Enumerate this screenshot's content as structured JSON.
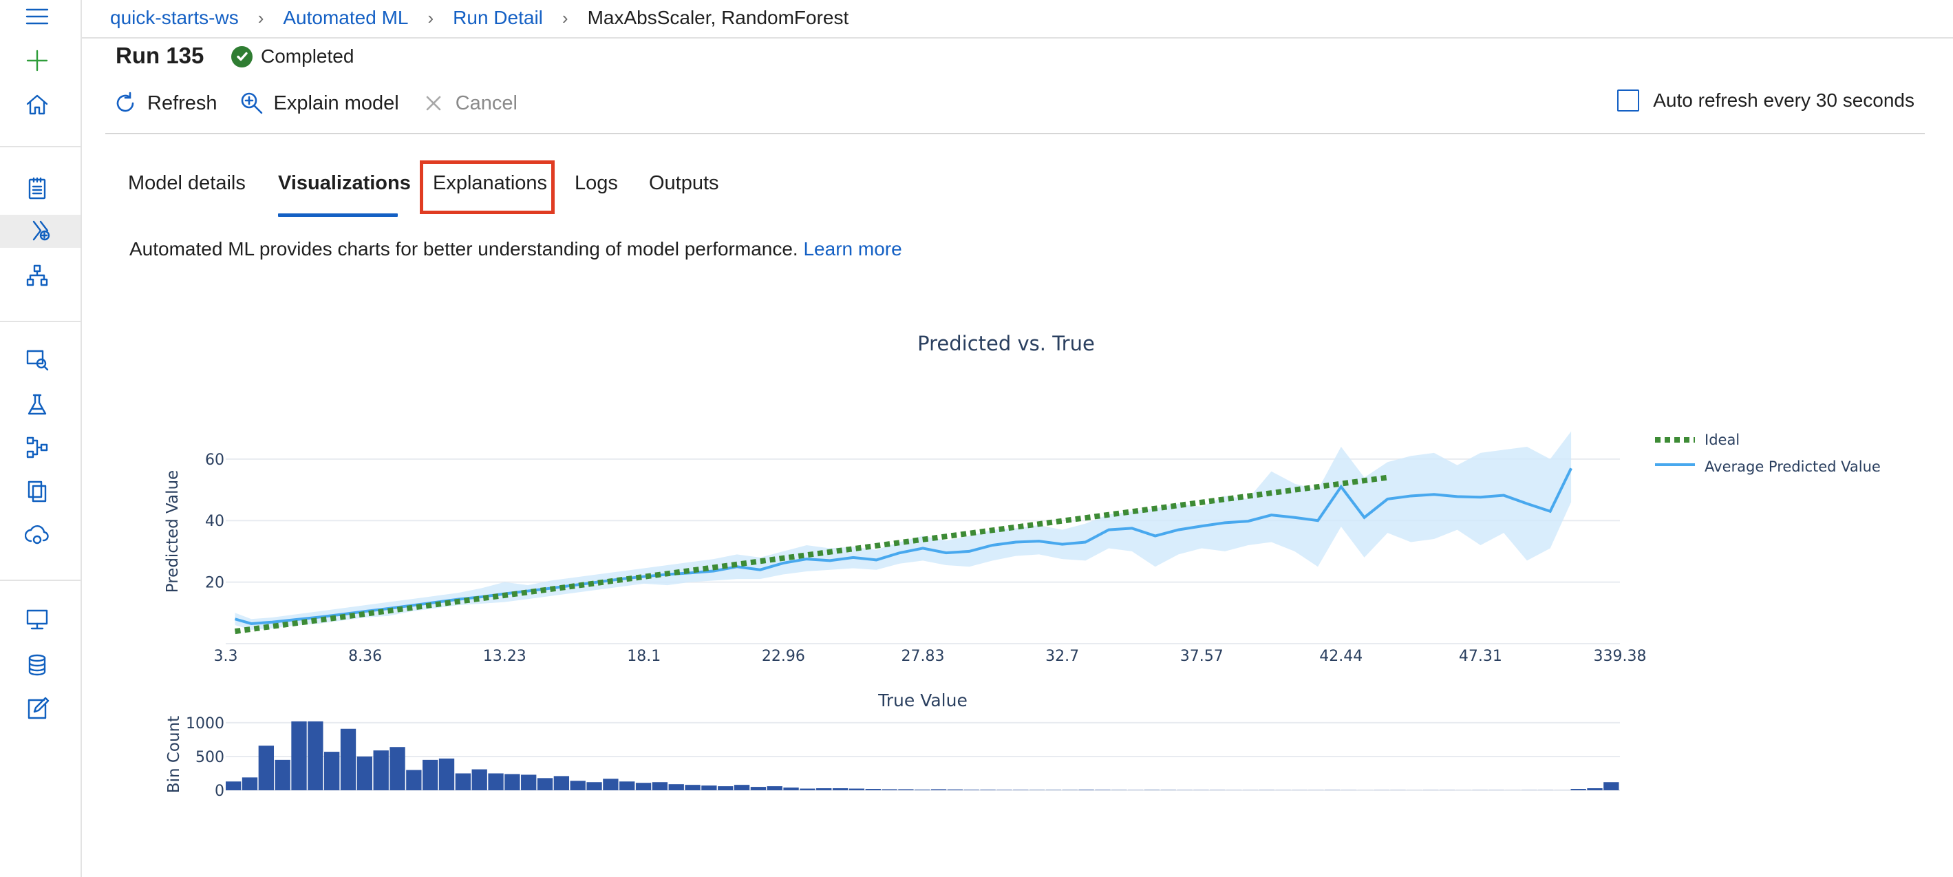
{
  "breadcrumb": {
    "items": [
      "quick-starts-ws",
      "Automated ML",
      "Run Detail"
    ],
    "current": "MaxAbsScaler, RandomForest"
  },
  "run": {
    "title": "Run 135",
    "status": "Completed"
  },
  "toolbar": {
    "refresh": "Refresh",
    "explain": "Explain model",
    "cancel": "Cancel",
    "auto_refresh": "Auto refresh every 30 seconds"
  },
  "tabs": [
    {
      "label": "Model details",
      "active": false
    },
    {
      "label": "Visualizations",
      "active": true
    },
    {
      "label": "Explanations",
      "active": false,
      "highlighted": true
    },
    {
      "label": "Logs",
      "active": false
    },
    {
      "label": "Outputs",
      "active": false
    }
  ],
  "description": {
    "text": "Automated ML provides charts for better understanding of model performance.",
    "link": "Learn more"
  },
  "colors": {
    "accent": "#1460c4",
    "ideal": "#3d8b35",
    "predicted": "#48a8ee",
    "band": "#cfe8fb",
    "histogram": "#2d55a4",
    "highlight": "#e03c22"
  },
  "chart_data": [
    {
      "type": "line",
      "title": "Predicted vs. True",
      "xlabel": "True Value",
      "ylabel": "Predicted Value",
      "x_ticks": [
        "3.3",
        "8.36",
        "13.23",
        "18.1",
        "22.96",
        "27.83",
        "32.7",
        "37.57",
        "42.44",
        "47.31",
        "339.38"
      ],
      "y_ticks": [
        20,
        40,
        60
      ],
      "ylim": [
        0,
        66
      ],
      "legend_position": "top-right",
      "series": [
        {
          "name": "Ideal",
          "style": "dotted",
          "points": [
            [
              0.4,
              4
            ],
            [
              50,
              54
            ]
          ]
        },
        {
          "name": "Average Predicted Value",
          "style": "solid",
          "points": [
            [
              0.4,
              8
            ],
            [
              1.1,
              6.5
            ],
            [
              2,
              7
            ],
            [
              3,
              7.8
            ],
            [
              4,
              8.6
            ],
            [
              5,
              9.5
            ],
            [
              6,
              10.5
            ],
            [
              7,
              11.4
            ],
            [
              8,
              12.4
            ],
            [
              9,
              13.4
            ],
            [
              10,
              14.4
            ],
            [
              11,
              15.2
            ],
            [
              12,
              16.2
            ],
            [
              13,
              17.1
            ],
            [
              14,
              18
            ],
            [
              15,
              19
            ],
            [
              16,
              20
            ],
            [
              17,
              21
            ],
            [
              18,
              21.8
            ],
            [
              19,
              22.5
            ],
            [
              20,
              23
            ],
            [
              21,
              23.6
            ],
            [
              22,
              25
            ],
            [
              23,
              24
            ],
            [
              24,
              26.2
            ],
            [
              25,
              27.5
            ],
            [
              26,
              27
            ],
            [
              27,
              28
            ],
            [
              28,
              27.2
            ],
            [
              29,
              29.5
            ],
            [
              30,
              31
            ],
            [
              31,
              29.5
            ],
            [
              32,
              30
            ],
            [
              33,
              32
            ],
            [
              34,
              33
            ],
            [
              35,
              33.3
            ],
            [
              36,
              32.3
            ],
            [
              37,
              33
            ],
            [
              38,
              37
            ],
            [
              39,
              37.5
            ],
            [
              40,
              35
            ],
            [
              41,
              37
            ],
            [
              42,
              38.2
            ],
            [
              43,
              39.3
            ],
            [
              44,
              39.8
            ],
            [
              45,
              41.8
            ],
            [
              46,
              41
            ],
            [
              47,
              40
            ],
            [
              48,
              51
            ],
            [
              49,
              41
            ],
            [
              50,
              47
            ],
            [
              51,
              48
            ],
            [
              52,
              48.5
            ],
            [
              53,
              47.8
            ],
            [
              54,
              47.6
            ],
            [
              55,
              48.2
            ],
            [
              56,
              45.5
            ],
            [
              57,
              43
            ],
            [
              57.9,
              57
            ]
          ],
          "band": {
            "upper": [
              10,
              8,
              8.5,
              9.5,
              10.5,
              11.5,
              12.5,
              13.5,
              14.5,
              15.5,
              16.5,
              18,
              20,
              19,
              20.5,
              21.5,
              22.5,
              23.5,
              24.5,
              25.5,
              26.5,
              27.5,
              29,
              28,
              30,
              32,
              31,
              31.5,
              30.5,
              33,
              35,
              33.5,
              35,
              37,
              37.5,
              38.5,
              37,
              39,
              42,
              43,
              44,
              45.5,
              44.5,
              48,
              47,
              56,
              52,
              50,
              64,
              54,
              59,
              61,
              62,
              58,
              62,
              63,
              64,
              60,
              69
            ],
            "lower": [
              6,
              4.5,
              5,
              6,
              6.5,
              7.5,
              8.5,
              9,
              10.5,
              11.5,
              12.5,
              13,
              13.5,
              14.5,
              15.5,
              16.5,
              17.5,
              18.5,
              19.5,
              19,
              20,
              20.5,
              21,
              21,
              22.5,
              23.5,
              24,
              24.5,
              24,
              26,
              27,
              25.5,
              25,
              27,
              28.5,
              29,
              27.5,
              27,
              31,
              30,
              25,
              29,
              31,
              30,
              32,
              33,
              30,
              25,
              38,
              28,
              36,
              33,
              34,
              37,
              32,
              36,
              27,
              31,
              46
            ]
          }
        }
      ]
    },
    {
      "type": "bar",
      "xlabel": "",
      "ylabel": "Bin Count",
      "y_ticks": [
        0,
        500,
        1000
      ],
      "ylim": [
        0,
        1050
      ],
      "values": [
        130,
        190,
        660,
        450,
        1020,
        1020,
        570,
        910,
        500,
        590,
        640,
        300,
        450,
        470,
        250,
        310,
        250,
        240,
        230,
        180,
        210,
        140,
        120,
        170,
        130,
        110,
        120,
        90,
        80,
        70,
        60,
        80,
        50,
        60,
        40,
        25,
        30,
        30,
        25,
        20,
        15,
        15,
        10,
        15,
        12,
        8,
        8,
        6,
        6,
        5,
        5,
        5,
        8,
        6,
        4,
        3,
        5,
        4,
        3,
        3,
        3,
        2,
        2,
        3,
        2,
        2,
        2,
        3,
        2,
        1,
        2,
        2,
        1,
        2,
        2,
        1,
        2,
        2,
        1,
        2,
        2,
        1,
        20,
        30,
        120
      ]
    }
  ]
}
